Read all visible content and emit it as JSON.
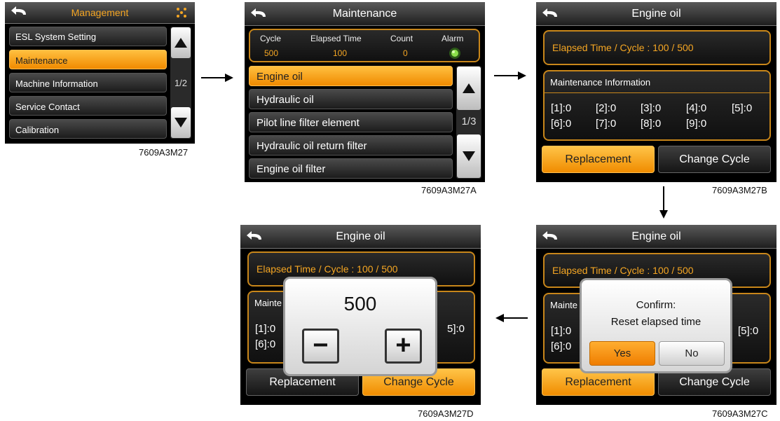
{
  "screen1": {
    "title": "Management",
    "items": [
      "ESL System Setting",
      "Maintenance",
      "Machine Information",
      "Service Contact",
      "Calibration"
    ],
    "page": "1/2",
    "caption": "7609A3M27"
  },
  "screen2": {
    "title": "Maintenance",
    "headers": [
      "Cycle",
      "Elapsed Time",
      "Count",
      "Alarm"
    ],
    "values": [
      "500",
      "100",
      "0"
    ],
    "items": [
      "Engine oil",
      "Hydraulic oil",
      "Pilot line filter element",
      "Hydraulic oil return filter",
      "Engine oil filter"
    ],
    "page": "1/3",
    "caption": "7609A3M27A"
  },
  "screen3": {
    "title": "Engine oil",
    "elapsed": "Elapsed Time / Cycle : 100 / 500",
    "info_title": "Maintenance Information",
    "info": [
      "[1]:0",
      "[2]:0",
      "[3]:0",
      "[4]:0",
      "[5]:0",
      "[6]:0",
      "[7]:0",
      "[8]:0",
      "[9]:0"
    ],
    "replacement": "Replacement",
    "change_cycle": "Change Cycle",
    "caption": "7609A3M27B"
  },
  "screen4": {
    "title": "Engine oil",
    "elapsed": "Elapsed Time / Cycle : 100 / 500",
    "info_title_partial": "Mainte",
    "info": [
      "[1]:0",
      "[5]:0",
      "[6]:0"
    ],
    "confirm_title": "Confirm:",
    "confirm_msg": "Reset elapsed time",
    "yes": "Yes",
    "no": "No",
    "replacement": "Replacement",
    "change_cycle": "Change Cycle",
    "caption": "7609A3M27C"
  },
  "screen5": {
    "title": "Engine oil",
    "elapsed": "Elapsed Time / Cycle : 100 / 500",
    "info_title_partial": "Mainte",
    "info": [
      "[1]:0",
      "[6]:0",
      "5]:0"
    ],
    "cycle_value": "500",
    "minus": "−",
    "plus": "+",
    "replacement": "Replacement",
    "change_cycle": "Change Cycle",
    "caption": "7609A3M27D"
  },
  "colors": {
    "accent": "#f5a623",
    "selected": "#f5a000"
  }
}
